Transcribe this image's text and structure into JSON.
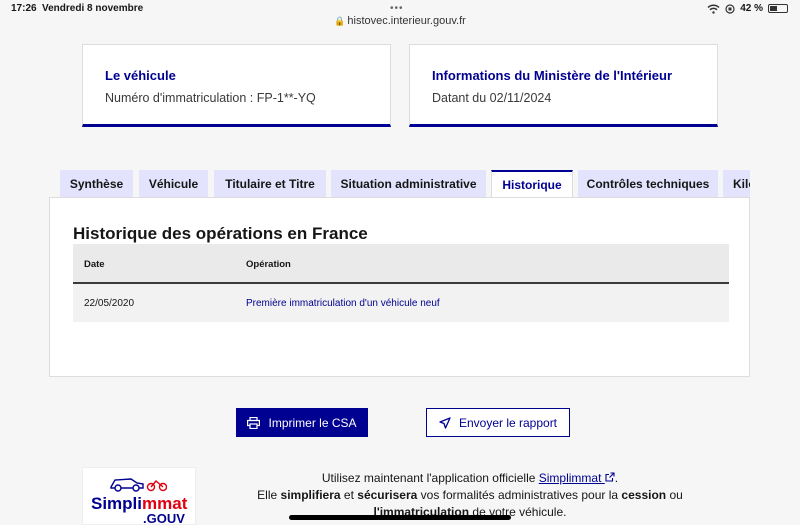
{
  "status_bar": {
    "time": "17:26",
    "date": "Vendredi 8 novembre",
    "battery": "42 %",
    "battery_level": 0.42,
    "url": "histovec.interieur.gouv.fr"
  },
  "cards": {
    "vehicle": {
      "title": "Le véhicule",
      "text": "Numéro d'immatriculation : FP-1**-YQ"
    },
    "ministry": {
      "title": "Informations du Ministère de l'Intérieur",
      "text": "Datant du 02/11/2024"
    }
  },
  "tabs": [
    {
      "label": "Synthèse"
    },
    {
      "label": "Véhicule"
    },
    {
      "label": "Titulaire et Titre"
    },
    {
      "label": "Situation administrative"
    },
    {
      "label": "Historique"
    },
    {
      "label": "Contrôles techniques"
    },
    {
      "label": "Kilométrage"
    }
  ],
  "active_tab": "Historique",
  "history": {
    "title": "Historique des opérations en France",
    "columns": [
      "Date",
      "Opération"
    ],
    "rows": [
      {
        "date": "22/05/2020",
        "operation": "Première immatriculation d'un véhicule neuf"
      }
    ]
  },
  "actions": {
    "print_label": "Imprimer le CSA",
    "send_label": "Envoyer le rapport"
  },
  "promo": {
    "logo_text": "Simplimmat .GOUV",
    "line1_pre": "Utilisez maintenant l'application officielle",
    "line1_link": "Simplimmat",
    "line1_post": ".",
    "line2_a": "Elle",
    "line2_b": "simplifiera",
    "line2_c": "et",
    "line2_d": "sécurisera",
    "line2_e": "vos formalités administratives pour la",
    "line2_f": "cession",
    "line2_g": "ou",
    "line3_a": "l'immatriculation",
    "line3_b": "de votre véhicule."
  },
  "colors": {
    "accent": "#000091",
    "tab_bg": "#e3e3fd",
    "logo_red": "#e1000f"
  }
}
